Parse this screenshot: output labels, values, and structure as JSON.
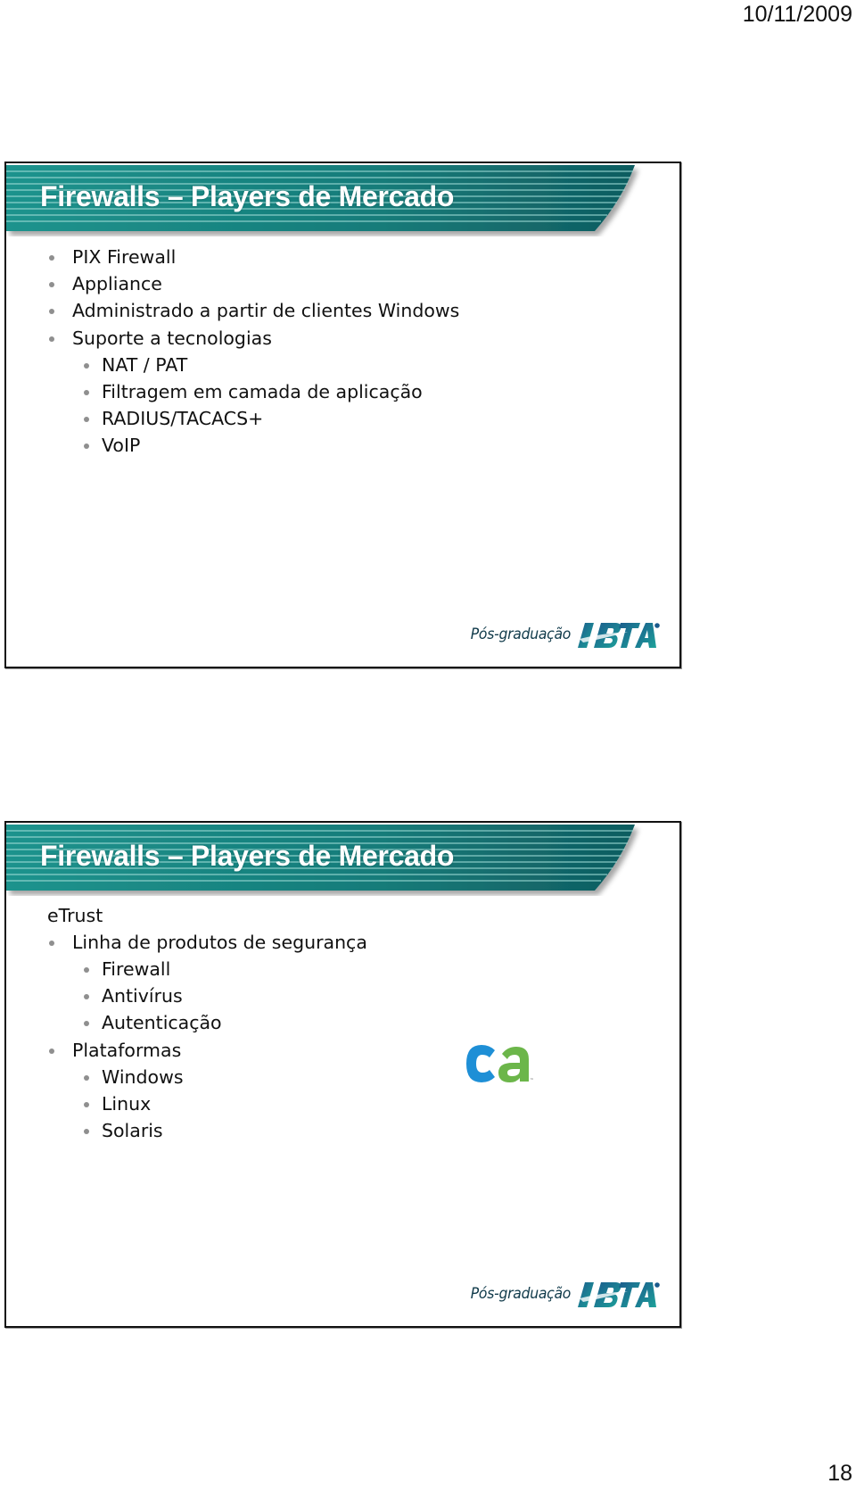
{
  "page": {
    "date": "10/11/2009",
    "number": "18"
  },
  "colors": {
    "banner_teal": "#1a8a86",
    "banner_dark": "#0f5f62",
    "banner_stripe": "#8fd0cc",
    "bullet": "#8f8f8f",
    "ca_blue": "#1e8fd6",
    "ca_green": "#6cb64a",
    "ibta_blue": "#1c5f8c",
    "ibta_teal": "#1ea39a"
  },
  "slides": [
    {
      "title": "Firewalls – Players de Mercado",
      "items": [
        {
          "level": 1,
          "text": "PIX Firewall"
        },
        {
          "level": 1,
          "text": "Appliance"
        },
        {
          "level": 1,
          "text": "Administrado a partir de clientes Windows"
        },
        {
          "level": 1,
          "text": "Suporte a tecnologias"
        },
        {
          "level": 2,
          "text": "NAT / PAT"
        },
        {
          "level": 2,
          "text": "Filtragem em camada de aplicação"
        },
        {
          "level": 2,
          "text": "RADIUS/TACACS+"
        },
        {
          "level": 2,
          "text": "VoIP"
        }
      ],
      "footer": {
        "text": "Pós-graduação",
        "logo": "IBTA"
      }
    },
    {
      "title": "Firewalls – Players de Mercado",
      "heading": "eTrust",
      "items": [
        {
          "level": 1,
          "text": "Linha de produtos de segurança"
        },
        {
          "level": 2,
          "text": "Firewall"
        },
        {
          "level": 2,
          "text": "Antivírus"
        },
        {
          "level": 2,
          "text": "Autenticação"
        },
        {
          "level": 1,
          "text": "Plataformas"
        },
        {
          "level": 2,
          "text": "Windows"
        },
        {
          "level": 2,
          "text": "Linux"
        },
        {
          "level": 2,
          "text": "Solaris"
        }
      ],
      "vendor_logo": {
        "text": "ca",
        "trademark": "™"
      },
      "footer": {
        "text": "Pós-graduação",
        "logo": "IBTA"
      }
    }
  ]
}
